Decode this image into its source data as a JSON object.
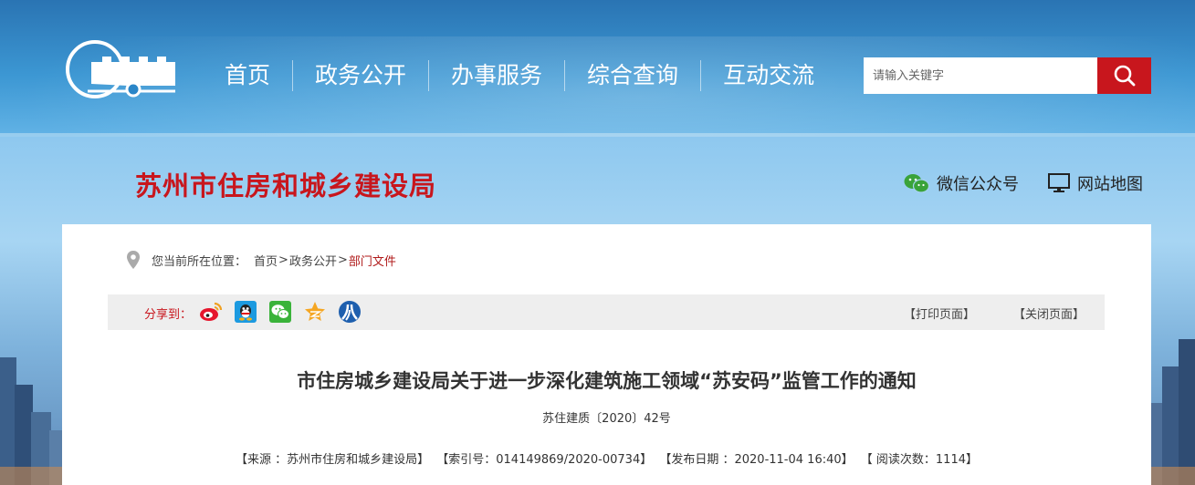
{
  "nav": {
    "items": [
      "首页",
      "政务公开",
      "办事服务",
      "综合查询",
      "互动交流"
    ]
  },
  "search": {
    "placeholder": "请输入关键字",
    "icon": "search-icon"
  },
  "site": {
    "title": "苏州市住房和城乡建设局"
  },
  "top_links": {
    "wechat": "微信公众号",
    "sitemap": "网站地图"
  },
  "breadcrumb": {
    "label": "您当前所在位置：",
    "home": "首页",
    "sep": ">",
    "section": "政务公开",
    "current": "部门文件"
  },
  "share": {
    "label": "分享到：",
    "icons": [
      "weibo-icon",
      "qq-icon",
      "wechat-icon",
      "qzone-icon",
      "renren-icon"
    ],
    "print": "【打印页面】",
    "close": "【关闭页面】"
  },
  "article": {
    "title": "市住房城乡建设局关于进一步深化建筑施工领域“苏安码”监管工作的通知",
    "doc_number": "苏住建质〔2020〕42号",
    "source": "【来源 ：苏州市住房和城乡建设局】",
    "index": "【索引号：014149869/2020-00734】",
    "published": "【发布日期 ：2020-11-04 16:40】",
    "views": "【 阅读次数：1114】"
  },
  "colors": {
    "accent_red": "#c8161d",
    "header_blue": "#2a74b3"
  }
}
